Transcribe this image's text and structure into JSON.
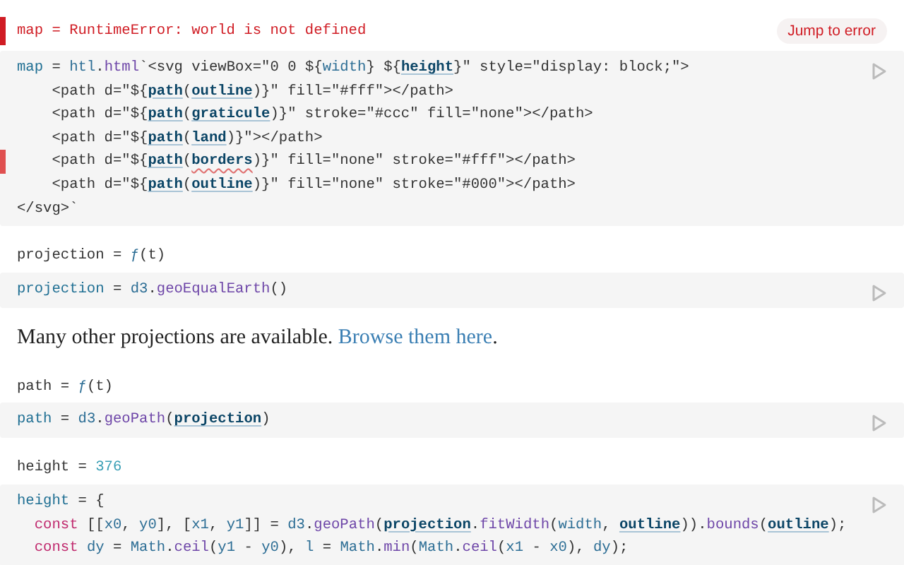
{
  "cells": [
    {
      "kind": "error",
      "tokens": [
        {
          "kind": "p",
          "t": "map = RuntimeError: world is not defined"
        }
      ],
      "action": "Jump to error"
    },
    {
      "kind": "code",
      "lines": [
        {
          "flagged": false,
          "tokens": [
            {
              "kind": "d",
              "t": "map"
            },
            {
              "kind": "p",
              "t": " = "
            },
            {
              "kind": "v",
              "t": "htl"
            },
            {
              "kind": "p",
              "t": "."
            },
            {
              "kind": "m",
              "t": "html"
            },
            {
              "kind": "p",
              "t": "`<svg viewBox=\"0 0 ${"
            },
            {
              "kind": "v",
              "t": "width"
            },
            {
              "kind": "p",
              "t": "} ${"
            },
            {
              "kind": "r",
              "t": "height"
            },
            {
              "kind": "p",
              "t": "}\" style=\"display: block;\">"
            }
          ]
        },
        {
          "flagged": false,
          "tokens": [
            {
              "kind": "p",
              "t": "    <path d=\"${"
            },
            {
              "kind": "r",
              "t": "path"
            },
            {
              "kind": "p",
              "t": "("
            },
            {
              "kind": "r",
              "t": "outline"
            },
            {
              "kind": "p",
              "t": ")}\" fill=\"#fff\"></path>"
            }
          ]
        },
        {
          "flagged": false,
          "tokens": [
            {
              "kind": "p",
              "t": "    <path d=\"${"
            },
            {
              "kind": "r",
              "t": "path"
            },
            {
              "kind": "p",
              "t": "("
            },
            {
              "kind": "r",
              "t": "graticule"
            },
            {
              "kind": "p",
              "t": ")}\" stroke=\"#ccc\" fill=\"none\"></path>"
            }
          ]
        },
        {
          "flagged": false,
          "tokens": [
            {
              "kind": "p",
              "t": "    <path d=\"${"
            },
            {
              "kind": "r",
              "t": "path"
            },
            {
              "kind": "p",
              "t": "("
            },
            {
              "kind": "r",
              "t": "land"
            },
            {
              "kind": "p",
              "t": ")}\"></path>"
            }
          ]
        },
        {
          "flagged": true,
          "tokens": [
            {
              "kind": "p",
              "t": "    <path d=\"${"
            },
            {
              "kind": "r",
              "t": "path"
            },
            {
              "kind": "p",
              "t": "("
            },
            {
              "kind": "e",
              "t": "borders"
            },
            {
              "kind": "p",
              "t": ")}\" fill=\"none\" stroke=\"#fff\"></path>"
            }
          ]
        },
        {
          "flagged": false,
          "tokens": [
            {
              "kind": "p",
              "t": "    <path d=\"${"
            },
            {
              "kind": "r",
              "t": "path"
            },
            {
              "kind": "p",
              "t": "("
            },
            {
              "kind": "r",
              "t": "outline"
            },
            {
              "kind": "p",
              "t": ")}\" fill=\"none\" stroke=\"#000\"></path>"
            }
          ]
        },
        {
          "flagged": false,
          "tokens": [
            {
              "kind": "p",
              "t": "</svg>`"
            }
          ]
        }
      ]
    },
    {
      "kind": "output",
      "tokens": [
        {
          "kind": "p",
          "t": "projection = "
        },
        {
          "kind": "v",
          "t": "ƒ"
        },
        {
          "kind": "p",
          "t": "(t)"
        }
      ]
    },
    {
      "kind": "code",
      "lines": [
        {
          "flagged": false,
          "tokens": [
            {
              "kind": "d",
              "t": "projection"
            },
            {
              "kind": "p",
              "t": " = "
            },
            {
              "kind": "v",
              "t": "d3"
            },
            {
              "kind": "p",
              "t": "."
            },
            {
              "kind": "m",
              "t": "geoEqualEarth"
            },
            {
              "kind": "p",
              "t": "()"
            }
          ]
        }
      ]
    },
    {
      "kind": "prose",
      "text": "Many other projections are available. ",
      "link": "Browse them here",
      "after": "."
    },
    {
      "kind": "output",
      "tokens": [
        {
          "kind": "p",
          "t": "path = "
        },
        {
          "kind": "v",
          "t": "ƒ"
        },
        {
          "kind": "p",
          "t": "(t)"
        }
      ]
    },
    {
      "kind": "code",
      "lines": [
        {
          "flagged": false,
          "tokens": [
            {
              "kind": "d",
              "t": "path"
            },
            {
              "kind": "p",
              "t": " = "
            },
            {
              "kind": "v",
              "t": "d3"
            },
            {
              "kind": "p",
              "t": "."
            },
            {
              "kind": "m",
              "t": "geoPath"
            },
            {
              "kind": "p",
              "t": "("
            },
            {
              "kind": "r",
              "t": "projection"
            },
            {
              "kind": "p",
              "t": ")"
            }
          ]
        }
      ]
    },
    {
      "kind": "output",
      "tokens": [
        {
          "kind": "p",
          "t": "height = "
        },
        {
          "kind": "n",
          "t": "376"
        }
      ]
    },
    {
      "kind": "code",
      "lines": [
        {
          "flagged": false,
          "tokens": [
            {
              "kind": "d",
              "t": "height"
            },
            {
              "kind": "p",
              "t": " = {"
            }
          ]
        },
        {
          "flagged": false,
          "tokens": [
            {
              "kind": "k",
              "t": "  const"
            },
            {
              "kind": "p",
              "t": " [["
            },
            {
              "kind": "v",
              "t": "x0"
            },
            {
              "kind": "p",
              "t": ", "
            },
            {
              "kind": "v",
              "t": "y0"
            },
            {
              "kind": "p",
              "t": "], ["
            },
            {
              "kind": "v",
              "t": "x1"
            },
            {
              "kind": "p",
              "t": ", "
            },
            {
              "kind": "v",
              "t": "y1"
            },
            {
              "kind": "p",
              "t": "]] = "
            },
            {
              "kind": "v",
              "t": "d3"
            },
            {
              "kind": "p",
              "t": "."
            },
            {
              "kind": "m",
              "t": "geoPath"
            },
            {
              "kind": "p",
              "t": "("
            },
            {
              "kind": "r",
              "t": "projection"
            },
            {
              "kind": "p",
              "t": "."
            },
            {
              "kind": "m",
              "t": "fitWidth"
            },
            {
              "kind": "p",
              "t": "("
            },
            {
              "kind": "v",
              "t": "width"
            },
            {
              "kind": "p",
              "t": ", "
            },
            {
              "kind": "r",
              "t": "outline"
            },
            {
              "kind": "p",
              "t": "))."
            },
            {
              "kind": "m",
              "t": "bounds"
            },
            {
              "kind": "p",
              "t": "("
            },
            {
              "kind": "r",
              "t": "outline"
            },
            {
              "kind": "p",
              "t": ");"
            }
          ]
        },
        {
          "flagged": false,
          "tokens": [
            {
              "kind": "k",
              "t": "  const"
            },
            {
              "kind": "v",
              "t": " dy"
            },
            {
              "kind": "p",
              "t": " = "
            },
            {
              "kind": "v",
              "t": "Math"
            },
            {
              "kind": "p",
              "t": "."
            },
            {
              "kind": "m",
              "t": "ceil"
            },
            {
              "kind": "p",
              "t": "("
            },
            {
              "kind": "v",
              "t": "y1"
            },
            {
              "kind": "p",
              "t": " - "
            },
            {
              "kind": "v",
              "t": "y0"
            },
            {
              "kind": "p",
              "t": "), "
            },
            {
              "kind": "v",
              "t": "l"
            },
            {
              "kind": "p",
              "t": " = "
            },
            {
              "kind": "v",
              "t": "Math"
            },
            {
              "kind": "p",
              "t": "."
            },
            {
              "kind": "m",
              "t": "min"
            },
            {
              "kind": "p",
              "t": "("
            },
            {
              "kind": "v",
              "t": "Math"
            },
            {
              "kind": "p",
              "t": "."
            },
            {
              "kind": "m",
              "t": "ceil"
            },
            {
              "kind": "p",
              "t": "("
            },
            {
              "kind": "v",
              "t": "x1"
            },
            {
              "kind": "p",
              "t": " - "
            },
            {
              "kind": "v",
              "t": "x0"
            },
            {
              "kind": "p",
              "t": "), "
            },
            {
              "kind": "v",
              "t": "dy"
            },
            {
              "kind": "p",
              "t": ");"
            }
          ]
        }
      ]
    }
  ]
}
